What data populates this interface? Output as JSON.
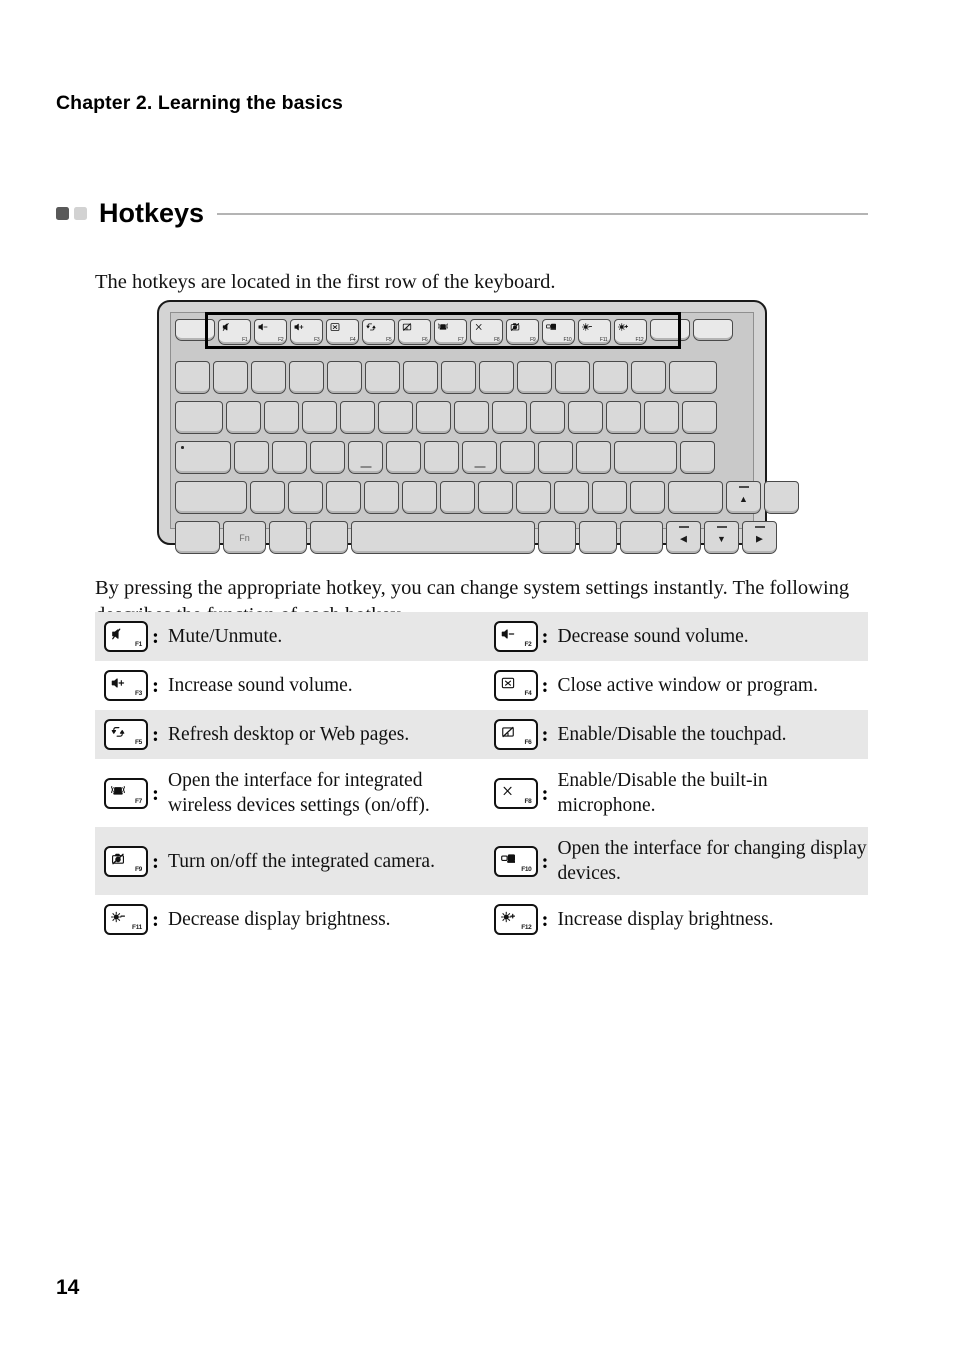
{
  "document": {
    "chapter_title": "Chapter 2. Learning the basics",
    "page_number": "14"
  },
  "section": {
    "title": "Hotkeys",
    "bullet_dark_color": "#595959",
    "bullet_light_color": "#d2d2d2",
    "rule_color": "#b4b4b4"
  },
  "paragraphs": {
    "intro": "The hotkeys are located in the first row of the keyboard.",
    "description": "By pressing the appropriate hotkey, you can change system settings instantly. The following describes the function of each hotkey."
  },
  "keyboard": {
    "caption": "Laptop keyboard illustration with the function-key row highlighted",
    "fn_key_label": "Fn",
    "function_row": [
      {
        "num": "F1",
        "icon": "speaker-mute-icon"
      },
      {
        "num": "F2",
        "icon": "volume-down-icon"
      },
      {
        "num": "F3",
        "icon": "volume-up-icon"
      },
      {
        "num": "F4",
        "icon": "close-window-icon"
      },
      {
        "num": "F5",
        "icon": "refresh-icon"
      },
      {
        "num": "F6",
        "icon": "touchpad-toggle-icon"
      },
      {
        "num": "F7",
        "icon": "wireless-icon"
      },
      {
        "num": "F8",
        "icon": "microphone-toggle-icon"
      },
      {
        "num": "F9",
        "icon": "camera-toggle-icon"
      },
      {
        "num": "F10",
        "icon": "display-switch-icon"
      },
      {
        "num": "F11",
        "icon": "brightness-down-icon"
      },
      {
        "num": "F12",
        "icon": "brightness-up-icon"
      }
    ]
  },
  "hotkey_table": {
    "rows": [
      {
        "shaded": true,
        "left": {
          "key": "F1",
          "icon": "speaker-mute-icon",
          "separator": ":",
          "description": "Mute/Unmute."
        },
        "right": {
          "key": "F2",
          "icon": "volume-down-icon",
          "separator": ":",
          "description": "Decrease sound volume."
        }
      },
      {
        "shaded": false,
        "left": {
          "key": "F3",
          "icon": "volume-up-icon",
          "separator": ":",
          "description": "Increase sound volume."
        },
        "right": {
          "key": "F4",
          "icon": "close-window-icon",
          "separator": ":",
          "description": "Close active window or program."
        }
      },
      {
        "shaded": true,
        "left": {
          "key": "F5",
          "icon": "refresh-icon",
          "separator": ":",
          "description": "Refresh desktop or Web pages."
        },
        "right": {
          "key": "F6",
          "icon": "touchpad-toggle-icon",
          "separator": ":",
          "description": "Enable/Disable the touchpad."
        }
      },
      {
        "shaded": false,
        "left": {
          "key": "F7",
          "icon": "wireless-icon",
          "separator": ":",
          "description": "Open the interface for integrated wireless devices settings (on/off)."
        },
        "right": {
          "key": "F8",
          "icon": "microphone-toggle-icon",
          "separator": ":",
          "description": "Enable/Disable the built-in microphone."
        }
      },
      {
        "shaded": true,
        "left": {
          "key": "F9",
          "icon": "camera-toggle-icon",
          "separator": ":",
          "description": "Turn on/off the integrated camera."
        },
        "right": {
          "key": "F10",
          "icon": "display-switch-icon",
          "separator": ":",
          "description": "Open the interface for changing display devices."
        }
      },
      {
        "shaded": false,
        "left": {
          "key": "F11",
          "icon": "brightness-down-icon",
          "separator": ":",
          "description": "Decrease display brightness."
        },
        "right": {
          "key": "F12",
          "icon": "brightness-up-icon",
          "separator": ":",
          "description": "Increase display brightness."
        }
      }
    ]
  }
}
